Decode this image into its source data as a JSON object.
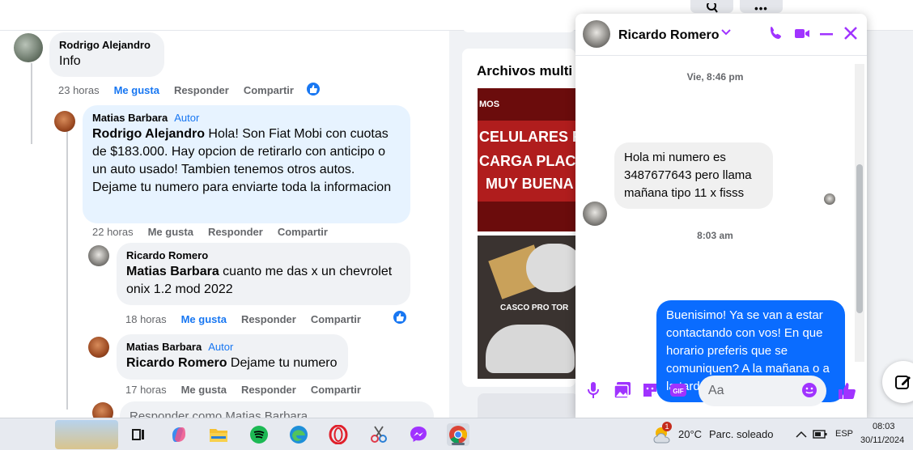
{
  "topbar": {
    "search_icon": "search-icon",
    "menu_icon": "more-icon"
  },
  "comments": [
    {
      "author": "Rodrigo Alejandro",
      "badge": "",
      "mention": "",
      "text": "Info",
      "time": "23 horas",
      "like": "Me gusta",
      "reply": "Responder",
      "share": "Compartir"
    },
    {
      "author": "Matias Barbara",
      "badge": "Autor",
      "mention": "Rodrigo Alejandro",
      "text": " Hola! Son Fiat Mobi con cuotas de $183.000. Hay opcion de retirarlo con anticipo o un auto usado! Tambien tenemos otros autos. Dejame tu numero para enviarte toda la informacion",
      "time": "22 horas",
      "like": "Me gusta",
      "reply": "Responder",
      "share": "Compartir"
    },
    {
      "author": "Ricardo Romero",
      "badge": "",
      "mention": "Matias Barbara",
      "text": " cuanto me das x un chevrolet onix 1.2 mod 2022",
      "time": "18 horas",
      "like": "Me gusta",
      "reply": "Responder",
      "share": "Compartir"
    },
    {
      "author": "Matias Barbara",
      "badge": "Autor",
      "mention": "Ricardo Romero",
      "text": " Dejame tu numero",
      "time": "17 horas",
      "like": "Me gusta",
      "reply": "Responder",
      "share": "Compartir"
    }
  ],
  "reply_box": {
    "placeholder": "Responder como Matias Barbara"
  },
  "media": {
    "title": "Archivos multi",
    "tile1_lines": [
      "MOS",
      "CELULARES RO",
      "CARGA PLACAS",
      "MUY BUENA"
    ],
    "tile2_caption": "CASCO PRO TOR"
  },
  "chat": {
    "name": "Ricardo Romero",
    "timestamp1": "Vie, 8:46 pm",
    "incoming": "Hola mi numero es 3487677643 pero llama mañana tipo 11 x fisss",
    "timestamp2": "8:03 am",
    "outgoing": "Buenisimo! Ya se van a estar contactando con vos! En que horario preferis que se comuniquen? A la mañana o a la tarde?",
    "input_placeholder": "Aa",
    "accent": "#a033ff",
    "bubble_out": "#0a6cff"
  },
  "taskbar": {
    "weather_temp": "20°C",
    "weather_desc": "Parc. soleado",
    "weather_badge": "1",
    "lang": "ESP",
    "time": "08:03",
    "date": "30/11/2024"
  }
}
